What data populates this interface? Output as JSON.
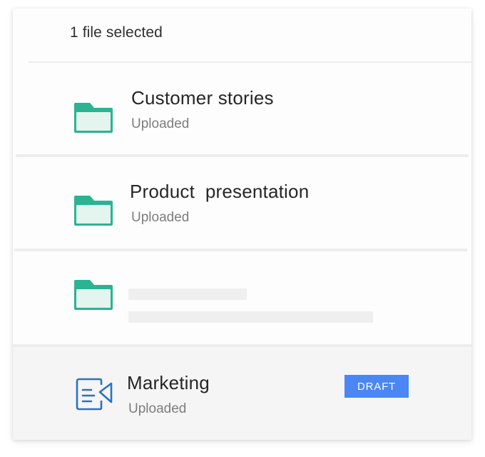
{
  "header": {
    "selection_text": "1 file selected"
  },
  "items": [
    {
      "title": "Customer stories",
      "status": "Uploaded",
      "icon": "folder-icon"
    },
    {
      "title": "Product  presentation",
      "status": "Uploaded",
      "icon": "folder-icon"
    },
    {
      "title": "",
      "status": "",
      "icon": "folder-icon",
      "loading": true
    },
    {
      "title": "Marketing",
      "status": "Uploaded",
      "icon": "document-send-icon",
      "badge": "DRAFT",
      "selected": true
    }
  ],
  "colors": {
    "folder_green": "#2bb392",
    "folder_fill": "#e4f4ef",
    "badge_blue": "#4a86f4",
    "doc_icon_blue": "#2a72c4",
    "selected_row_bg": "#f5f5f5"
  }
}
